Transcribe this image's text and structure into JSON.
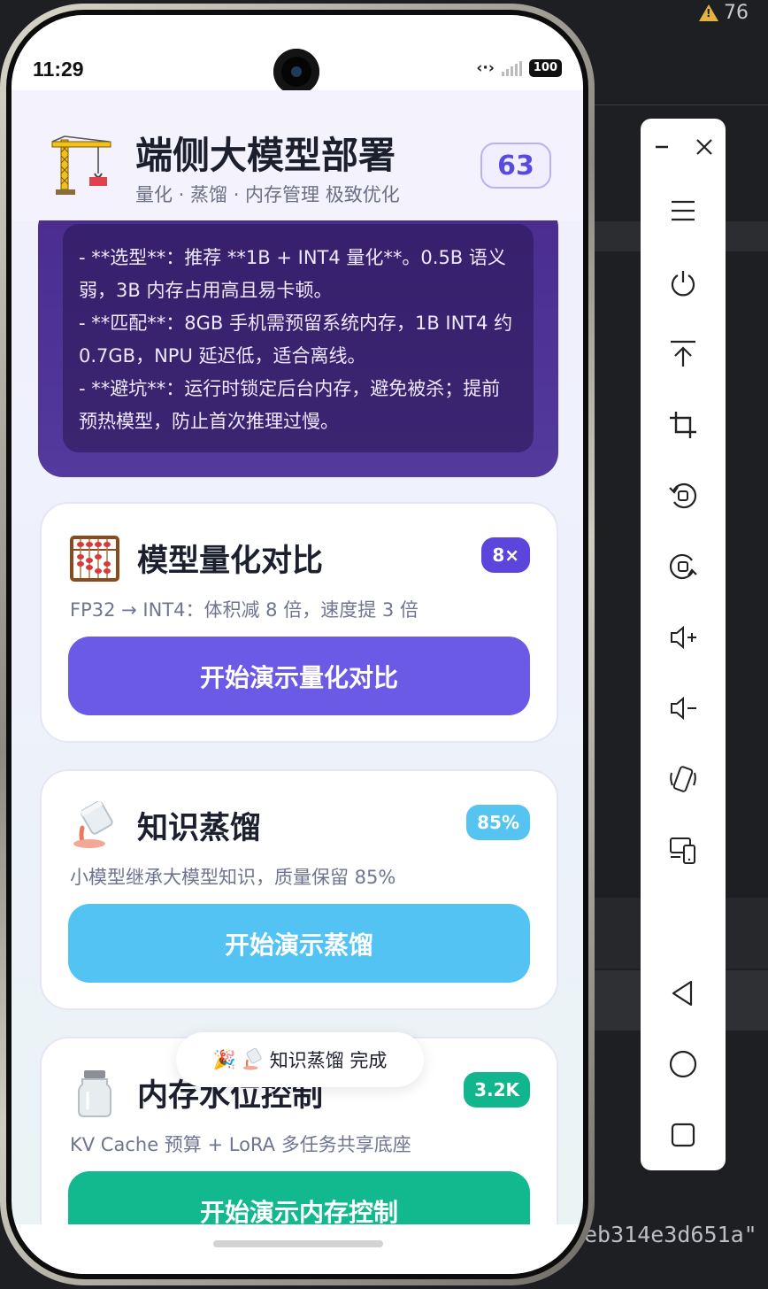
{
  "ide": {
    "warning_count": "76",
    "code_fragment": "eb314e3d651a\""
  },
  "status": {
    "time": "11:29",
    "network": "‹·›",
    "battery": "100"
  },
  "header": {
    "title": "端侧大模型部署",
    "subtitle": "量化 · 蒸馏 · 内存管理 极致优化",
    "count_badge": "63"
  },
  "tips": {
    "lines": [
      "- **选型**：推荐 **1B + INT4 量化**。0.5B 语义弱，3B 内存占用高且易卡顿。",
      "- **匹配**：8GB 手机需预留系统内存，1B INT4 约 0.7GB，NPU 延迟低，适合离线。",
      "- **避坑**：运行时锁定后台内存，避免被杀；提前预热模型，防止首次推理过慢。"
    ]
  },
  "cards": [
    {
      "icon": "abacus-icon",
      "title": "模型量化对比",
      "badge": "8×",
      "badge_color": "#5b45dd",
      "desc": "FP32 → INT4：体积减 8 倍，速度提 3 倍",
      "button": "开始演示量化对比",
      "button_color": "#6b5ae6"
    },
    {
      "icon": "pouring-liquid-icon",
      "title": "知识蒸馏",
      "badge": "85%",
      "badge_color": "#55c4f1",
      "desc": "小模型继承大模型知识，质量保留 85%",
      "button": "开始演示蒸馏",
      "button_color": "#53c3f4"
    },
    {
      "icon": "jar-icon",
      "title": "内存水位控制",
      "badge": "3.2K",
      "badge_color": "#11b68f",
      "desc": "KV Cache 预算 + LoRA 多任务共享底座",
      "button": "开始演示内存控制",
      "button_color": "#12b98f"
    }
  ],
  "toast": {
    "emoji": "🎉",
    "text": "知识蒸馏 完成"
  },
  "toolbar": {
    "items": [
      "minimize",
      "close",
      "menu",
      "power",
      "top",
      "crop",
      "rotate-left",
      "rotate-right",
      "volume-up",
      "volume-down",
      "shake",
      "multi-device",
      "back",
      "home",
      "overview"
    ]
  }
}
